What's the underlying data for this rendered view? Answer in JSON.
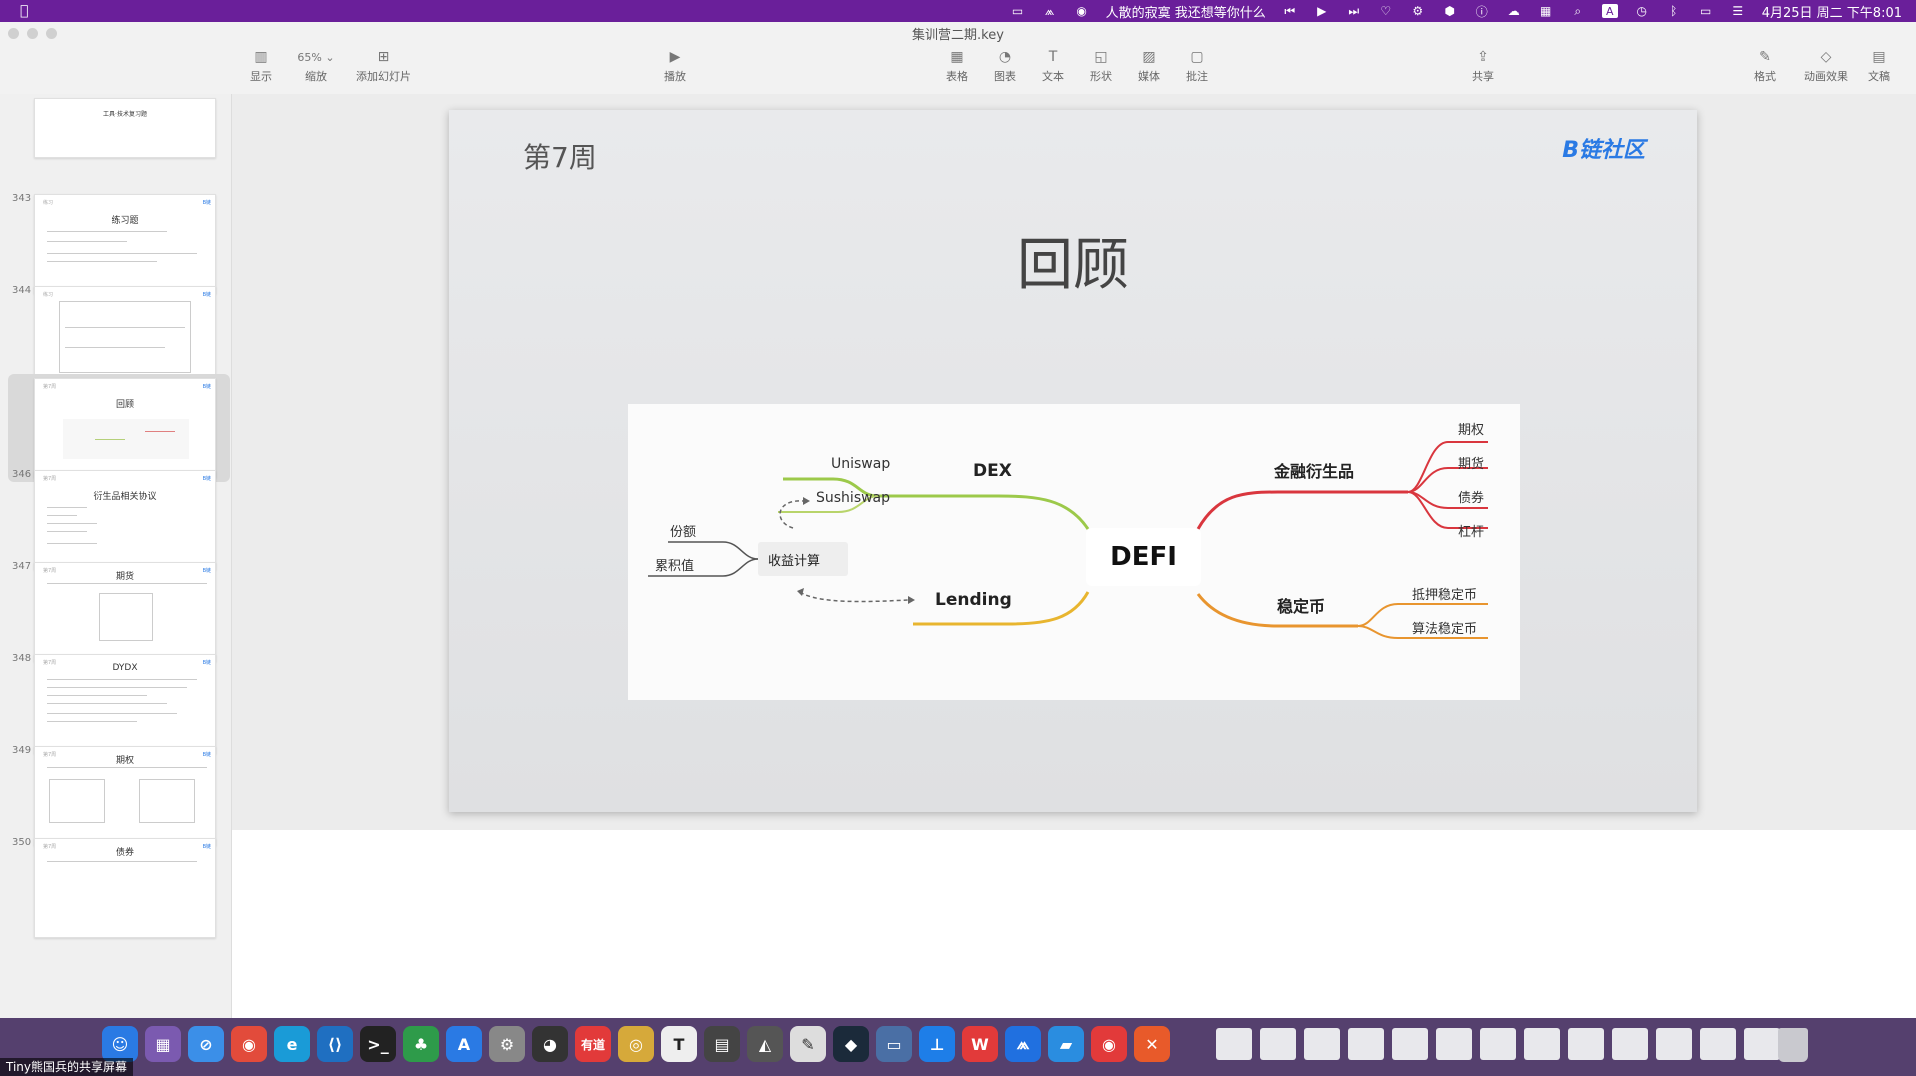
{
  "menubar": {
    "now_playing": "人散的寂寞 我还想等你什么",
    "datetime": "4月25日 周二 下午8:01",
    "input_icon": "A"
  },
  "window": {
    "title": "集训营二期.key"
  },
  "toolbar": {
    "display": "显示",
    "zoom_value": "65% ⌄",
    "zoom": "缩放",
    "add_slide": "添加幻灯片",
    "play": "播放",
    "table": "表格",
    "chart": "图表",
    "text": "文本",
    "shape": "形状",
    "media": "媒体",
    "comment": "批注",
    "share": "共享",
    "format": "格式",
    "animate": "动画效果",
    "document": "文稿"
  },
  "sidebar": {
    "slides": [
      {
        "num": "343",
        "title": "工具·技术复习题"
      },
      {
        "num": "344",
        "title": "练习题"
      },
      {
        "num": "345",
        "title": ""
      },
      {
        "num": "346",
        "title": "回顾"
      },
      {
        "num": "347",
        "title": "衍生品相关协议"
      },
      {
        "num": "348",
        "title": "期货"
      },
      {
        "num": "349",
        "title": "DYDX"
      },
      {
        "num": "350",
        "title": "期权"
      },
      {
        "num": "",
        "title": "债券"
      }
    ]
  },
  "slide": {
    "week": "第7周",
    "brand": "B链社区",
    "title": "回顾",
    "mindmap": {
      "center": "DEFI",
      "dex": "DEX",
      "uniswap": "Uniswap",
      "sushiswap": "Sushiswap",
      "lending": "Lending",
      "derivatives": "金融衍生品",
      "options": "期权",
      "futures": "期货",
      "bonds": "债券",
      "leverage": "杠杆",
      "stablecoin": "稳定币",
      "collateral_stable": "抵押稳定币",
      "algo_stable": "算法稳定币",
      "yield_calc": "收益计算",
      "shares": "份额",
      "accumulated": "累积值"
    }
  },
  "colors": {
    "menubar": "#6a1f9a",
    "dock": "#55406e",
    "accent_red": "#d9363e",
    "accent_orange": "#e8952f",
    "accent_green": "#9cc94a",
    "brand_blue": "#2a7ae4"
  },
  "screen_share": {
    "label": "Tiny熊国兵的共享屏幕"
  }
}
